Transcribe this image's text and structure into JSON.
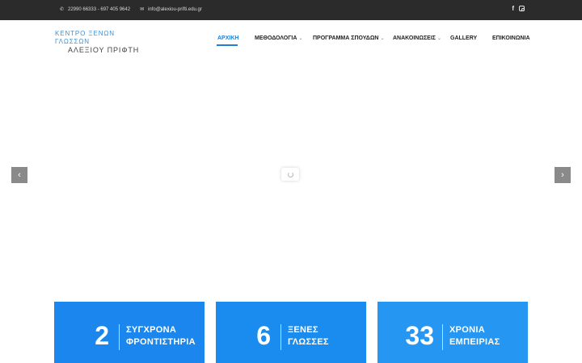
{
  "topbar": {
    "phone": "22990 66333 - 697 405 9642",
    "email": "info@alexiou-prifti.edu.gr",
    "social": [
      {
        "icon": "facebook-icon",
        "glyph": "f"
      },
      {
        "icon": "instagram-icon",
        "glyph": ""
      }
    ]
  },
  "logo": {
    "line1": "ΚΕΝΤΡΟ ΞΕΝΩΝ ΓΛΩΣΣΩΝ",
    "line2": "ΑΛΕΞΙΟΥ ΠΡΙΦΤΗ"
  },
  "nav": {
    "items": [
      {
        "label": "ΑΡΧΙΚΗ",
        "active": true,
        "dropdown": false
      },
      {
        "label": "ΜΕΘΟΔΟΛΟΓΙΑ",
        "active": false,
        "dropdown": true
      },
      {
        "label": "ΠΡΟΓΡΑΜΜΑ ΣΠΟΥΔΩΝ",
        "active": false,
        "dropdown": true
      },
      {
        "label": "ΑΝΑΚΟΙΝΩΣΕΙΣ",
        "active": false,
        "dropdown": true
      },
      {
        "label": "GALLERY",
        "active": false,
        "dropdown": false
      },
      {
        "label": "ΕΠΙΚΟΙΝΩΝΙΑ",
        "active": false,
        "dropdown": false
      }
    ]
  },
  "slider": {
    "prev_glyph": "‹",
    "next_glyph": "›"
  },
  "stats": [
    {
      "number": "2",
      "line1": "ΣΥΓΧΡΟΝΑ",
      "line2": "ΦΡΟΝΤΙΣΤΗΡΙΑ",
      "color": "#1a86ee"
    },
    {
      "number": "6",
      "line1": "ΞΕΝΕΣ",
      "line2": "ΓΛΩΣΣΕΣ",
      "color": "#1a8cf0"
    },
    {
      "number": "33",
      "line1": "ΧΡΟΝΙΑ",
      "line2": "ΕΜΠΕΙΡΙΑΣ",
      "color": "#2596f2"
    }
  ],
  "colors": {
    "accent": "#1e7fd8",
    "topbar": "#2b2b2b"
  }
}
